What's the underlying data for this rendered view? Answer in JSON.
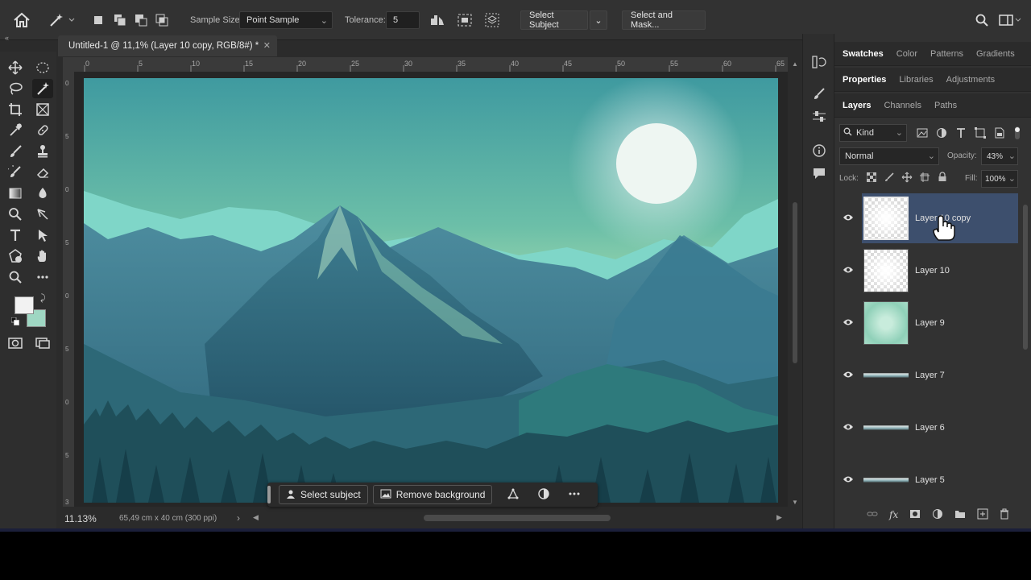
{
  "options_bar": {
    "sample_size_label": "Sample Size:",
    "sample_size_value": "Point Sample",
    "tolerance_label": "Tolerance:",
    "tolerance_value": "5",
    "select_subject": "Select Subject",
    "select_and_mask": "Select and Mask..."
  },
  "document": {
    "tab_title": "Untitled-1 @ 11,1% (Layer 10 copy, RGB/8#) *"
  },
  "rulers": {
    "top": [
      "0",
      "5",
      "10",
      "15",
      "20",
      "25",
      "30",
      "35",
      "40",
      "45",
      "50",
      "55",
      "60",
      "65"
    ],
    "left": [
      "0",
      "5",
      "0",
      "5",
      "0",
      "5",
      "0",
      "5",
      "3"
    ]
  },
  "status": {
    "zoom": "11.13%",
    "doc_info": "65,49 cm x 40 cm (300 ppi)"
  },
  "task_bar": {
    "select_subject": "Select subject",
    "remove_background": "Remove background"
  },
  "panels": {
    "row1": [
      "Swatches",
      "Color",
      "Patterns",
      "Gradients"
    ],
    "row2": [
      "Properties",
      "Libraries",
      "Adjustments"
    ],
    "row3": [
      "Layers",
      "Channels",
      "Paths"
    ]
  },
  "layers_panel": {
    "filter_kind": "Kind",
    "blend_mode": "Normal",
    "opacity_label": "Opacity:",
    "opacity_value": "43%",
    "lock_label": "Lock:",
    "fill_label": "Fill:",
    "fill_value": "100%",
    "layers": [
      {
        "name": "Layer 10 copy",
        "selected": true
      },
      {
        "name": "Layer 10",
        "selected": false
      },
      {
        "name": "Layer 9",
        "selected": false
      },
      {
        "name": "Layer 7",
        "selected": false
      },
      {
        "name": "Layer 6",
        "selected": false
      },
      {
        "name": "Layer 5",
        "selected": false
      }
    ]
  },
  "colors": {
    "foreground": "#f2f2f2",
    "background": "#9fd7c3",
    "selection": "#3d4f6d"
  }
}
